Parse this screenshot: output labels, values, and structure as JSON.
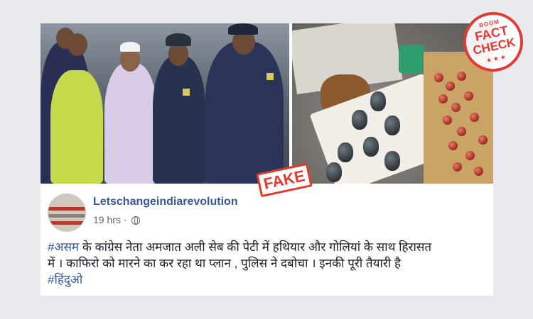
{
  "post": {
    "page_name": "Letschangeindiarevolution",
    "timestamp": "19 hrs",
    "separator": "·",
    "privacy_icon": "globe-icon",
    "message": {
      "hashtag_start": "#असम",
      "line1_rest": " के कांग्रेस नेता अमजात अली सेब की पेटी में हथियार और गोलियां के साथ हिरासत",
      "line2": "में । काफिरो को मारने का कर रहा था प्लान , पुलिस ने दबोचा । इनकी पूरी तैयारी है",
      "hashtag_end": "#हिंदुओ"
    }
  },
  "stamps": {
    "fake": "FAKE",
    "factcheck_brand": "BOOM",
    "factcheck_line1": "FACT",
    "factcheck_line2": "CHECK",
    "factcheck_stars": "★★★"
  },
  "colors": {
    "link": "#365899",
    "text": "#1d2129",
    "meta": "#606770",
    "stamp_red": "#e53935",
    "page_bg": "#e9eaee"
  },
  "images": [
    {
      "name": "police-custody-photo"
    },
    {
      "name": "grenades-apples-photo"
    }
  ]
}
